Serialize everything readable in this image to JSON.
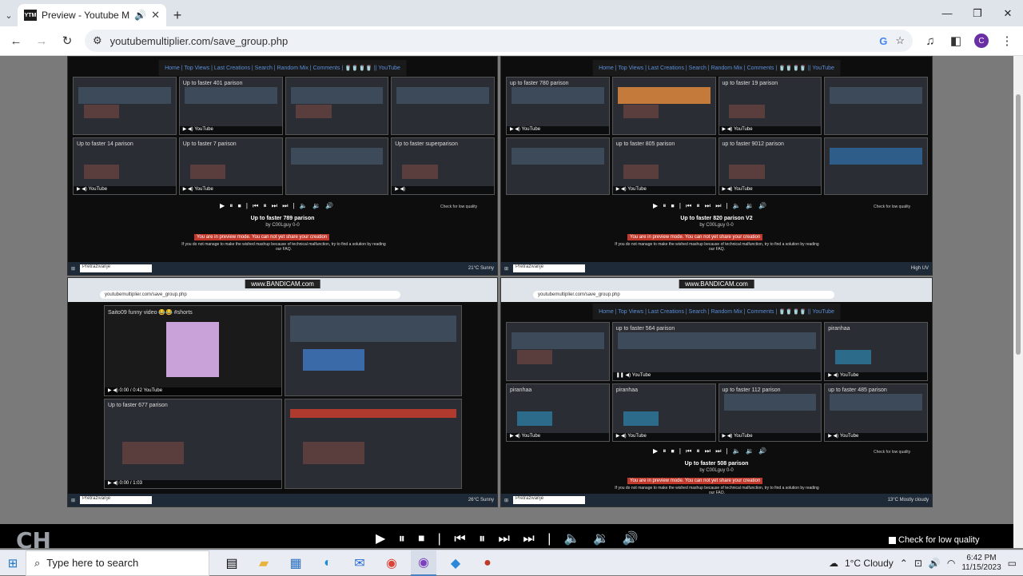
{
  "browser": {
    "tab_title": "Preview - Youtube Multiplie",
    "tab_favicon": "YTM",
    "url": "youtubemultiplier.com/save_group.php",
    "avatar_letter": "C"
  },
  "site": {
    "nav": "Home | Top Views | Last Creations | Search | Random Mix | Comments | 🥤🥤🥤🥤 || YouTube"
  },
  "panels": [
    {
      "videos": [
        "",
        "Up to faster 401 parison",
        "",
        "",
        "Up to faster 14 parison",
        "Up to faster 7 parison",
        "",
        "Up to faster superparison"
      ],
      "title": "Up to faster 789 parison",
      "by": "by C00Lguy 0-0",
      "warning": "You are in preview mode. You can not yet share your creation",
      "help": "If you do not manage to make the wished mashup because of technical malfunction, try to find a solution by reading our FAQ.",
      "check": "Check for low quality",
      "taskbar_search": "Pretraživanje",
      "weather": "21°C Sunny"
    },
    {
      "videos": [
        "up to faster 780 parison",
        "",
        "up to faster 19 parison",
        "",
        "",
        "up to faster 805 parison",
        "up to faster 9012 parison",
        ""
      ],
      "title": "Up to faster 820 parison V2",
      "by": "by C00Lguy 0-0",
      "warning": "You are in preview mode. You can not yet share your creation",
      "help": "If you do not manage to make the wished mashup because of technical malfunction, try to find a solution by reading our FAQ.",
      "check": "Check for low quality",
      "taskbar_search": "Pretraživanje",
      "weather": "High UV"
    },
    {
      "bandicam": "www.BANDICAM.com",
      "url": "youtubemultiplier.com/save_group.php",
      "videos": [
        "Saito09 funny video 😂😂 #shorts",
        "",
        "Up to faster 677 parison",
        ""
      ],
      "taskbar_search": "Pretraživanje",
      "weather": "26°C Sunny"
    },
    {
      "bandicam": "www.BANDICAM.com",
      "url": "youtubemultiplier.com/save_group.php",
      "videos": [
        "",
        "up to faster 564 parison",
        "piranhaa",
        "piranhaa",
        "piranhaa",
        "up to faster 112 parison",
        "up to faster 485 parison"
      ],
      "title": "Up to faster 508 parison",
      "by": "by C00Lguy 0-0",
      "warning": "You are in preview mode. You can not yet share your creation",
      "help": "If you do not manage to make the wished mashup because of technical malfunction, try to find a solution by reading our FAQ.",
      "check": "Check for low quality",
      "taskbar_search": "Pretraživanje",
      "weather": "13°C Mostly cloudy"
    }
  ],
  "player": {
    "controls": "▶ ⏸ ⏹ | ⏮ ⏸ ⏭ ⏭ | 🔈 🔉 🔊",
    "check_label": "Check for low quality",
    "watermark": "CH"
  },
  "taskbar": {
    "search_placeholder": "Type here to search",
    "weather": "1°C  Cloudy",
    "time": "6:42 PM",
    "date": "11/15/2023"
  }
}
